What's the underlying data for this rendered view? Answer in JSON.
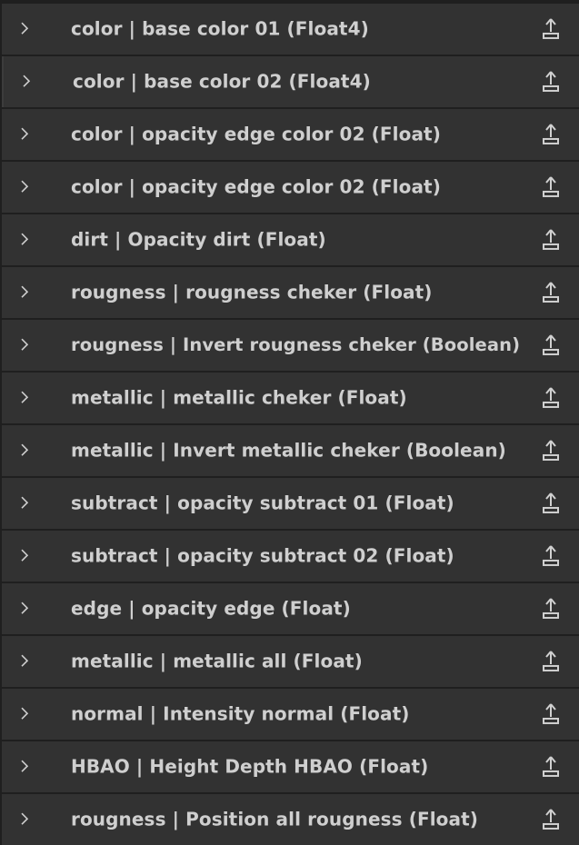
{
  "rows": [
    {
      "label": "color | base color 01 (Float4)"
    },
    {
      "label": "color | base color 02 (Float4)"
    },
    {
      "label": "color | opacity edge color 02 (Float)"
    },
    {
      "label": "color | opacity edge color 02 (Float)"
    },
    {
      "label": "dirt | Opacity dirt (Float)"
    },
    {
      "label": "rougness | rougness cheker (Float)"
    },
    {
      "label": "rougness | Invert rougness cheker (Boolean)"
    },
    {
      "label": "metallic | metallic cheker (Float)"
    },
    {
      "label": "metallic | Invert metallic cheker (Boolean)"
    },
    {
      "label": "subtract | opacity subtract 01 (Float)"
    },
    {
      "label": "subtract | opacity subtract 02 (Float)"
    },
    {
      "label": "edge | opacity edge (Float)"
    },
    {
      "label": "metallic | metallic all (Float)"
    },
    {
      "label": "normal | Intensity normal (Float)"
    },
    {
      "label": "HBAO | Height Depth HBAO (Float)"
    },
    {
      "label": "rougness | Position all rougness (Float)"
    }
  ],
  "icons": {
    "expand": "chevron-right-icon",
    "export": "export-icon"
  },
  "colors": {
    "row_bg": "#323232",
    "separator": "#1f1f1f",
    "text": "#cfcfcf",
    "icon": "#d0d0d0"
  }
}
